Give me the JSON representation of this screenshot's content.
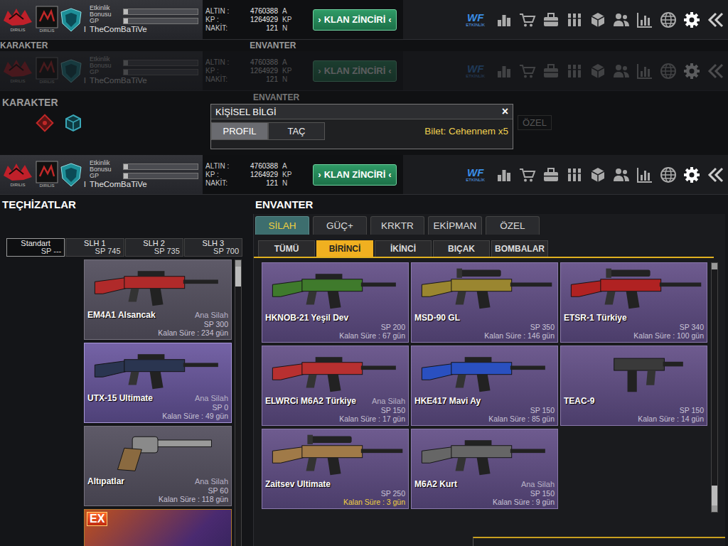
{
  "top_bar": {
    "clan_tag": "DIRILIS",
    "rank": "I",
    "meters": [
      {
        "label": "Etkinlik Bonusu",
        "level": 0.06
      },
      {
        "label": "GP",
        "level": 0.06
      }
    ],
    "player": "TheComBaTiVe",
    "currencies": [
      {
        "label": "ALTIN :",
        "value": "4760388",
        "unit": "A"
      },
      {
        "label": "KP :",
        "value": "1264929",
        "unit": "KP"
      },
      {
        "label": "NAKİT:",
        "value": "121",
        "unit": "N"
      }
    ],
    "clan_button": {
      "left_mark": "›",
      "label": "KLAN ZİNCİRİ",
      "right_mark": "‹"
    },
    "event_logo": {
      "mark": "WF",
      "label": "ETKİNLİK"
    }
  },
  "top_bar_copies": [
    {
      "dimmed": false
    },
    {
      "dimmed": true
    },
    {
      "dimmed": false
    }
  ],
  "faded_headers": {
    "left": "KARAKTER",
    "right": "ENVANTER"
  },
  "character": {
    "title": "KARAKTER",
    "inventory_title": "ENVANTER",
    "hidden_tab": "ÖZEL"
  },
  "dialog": {
    "title": "KİŞİSEL BİLGİ",
    "close": "×",
    "tabs": [
      {
        "label": "PROFIL",
        "selected": true
      },
      {
        "label": "TAÇ",
        "selected": false
      }
    ],
    "ticket": "Bilet: Cehennem x5"
  },
  "equipment": {
    "title": "TEÇHİZATLAR",
    "slots": [
      {
        "label": "Standart",
        "sp": "SP ---",
        "selected": true
      },
      {
        "label": "SLH 1",
        "sp": "SP 745",
        "selected": false
      },
      {
        "label": "SLH 2",
        "sp": "SP 735",
        "selected": false
      },
      {
        "label": "SLH 3",
        "sp": "SP 700",
        "selected": false
      }
    ],
    "items": [
      {
        "name": "EM4A1 Alsancak",
        "type": "Ana Silah",
        "sp": "SP 300",
        "remaining": "Kalan Süre : 234 gün",
        "kind": "rifle",
        "color": "#b02a2a",
        "selected": false
      },
      {
        "name": "UTX-15 Ultimate",
        "type": "Ana Silah",
        "sp": "SP 0",
        "remaining": "Kalan Süre : 49 gün",
        "kind": "rifle",
        "color": "#2a3550",
        "selected": true
      },
      {
        "name": "Altıpatlar",
        "type": "Ana Silah",
        "sp": "SP 60",
        "remaining": "Kalan Süre : 118 gün",
        "kind": "pistol",
        "color": "#8a6a40",
        "selected": false
      }
    ],
    "partial_item": {
      "badge": "EX"
    }
  },
  "inventory": {
    "title": "ENVANTER",
    "tabs": [
      {
        "label": "SİLAH",
        "selected": true
      },
      {
        "label": "GÜÇ+",
        "selected": false
      },
      {
        "label": "KRKTR",
        "selected": false
      },
      {
        "label": "EKİPMAN",
        "selected": false
      },
      {
        "label": "ÖZEL",
        "selected": false
      }
    ],
    "subtabs": [
      {
        "label": "TÜMÜ",
        "selected": false
      },
      {
        "label": "BİRİNCİ",
        "selected": true
      },
      {
        "label": "İKİNCİ",
        "selected": false
      },
      {
        "label": "BIÇAK",
        "selected": false
      },
      {
        "label": "BOMBALAR",
        "selected": false
      }
    ],
    "items": [
      {
        "name": "HKNOB-21 Yeşil Dev",
        "sp": "SP 200",
        "remaining": "Kalan Süre : 67 gün",
        "kind": "rifle",
        "color": "#3f7a2c",
        "warning": false
      },
      {
        "name": "MSD-90 GL",
        "sp": "SP 350",
        "remaining": "Kalan Süre : 146 gün",
        "kind": "sniper",
        "color": "#9a8630",
        "warning": false
      },
      {
        "name": "ETSR-1 Türkiye",
        "sp": "SP 340",
        "remaining": "Kalan Süre : 100 gün",
        "kind": "sniper",
        "color": "#b02222",
        "warning": false
      },
      {
        "name": "ELWRCi M6A2 Türkiye",
        "type": "Ana Silah",
        "sp": "SP 150",
        "remaining": "Kalan Süre : 17 gün",
        "kind": "rifle",
        "color": "#b83030",
        "warning": false
      },
      {
        "name": "HKE417 Mavi Ay",
        "sp": "SP 150",
        "remaining": "Kalan Süre : 85 gün",
        "kind": "rifle",
        "color": "#2a50c0",
        "warning": false
      },
      {
        "name": "TEAC-9",
        "sp": "SP 150",
        "remaining": "Kalan Süre : 14 gün",
        "kind": "smg",
        "color": "#3a3a3a",
        "warning": false
      },
      {
        "name": "Zaitsev Ultimate",
        "sp": "SP 250",
        "remaining": "Kalan Süre : 3 gün",
        "kind": "sniper",
        "color": "#a07a48",
        "warning": true
      },
      {
        "name": "M6A2 Kurt",
        "type": "Ana Silah",
        "sp": "SP 150",
        "remaining": "Kalan Süre : 9 gün",
        "kind": "rifle",
        "color": "#666666",
        "warning": false
      }
    ]
  }
}
